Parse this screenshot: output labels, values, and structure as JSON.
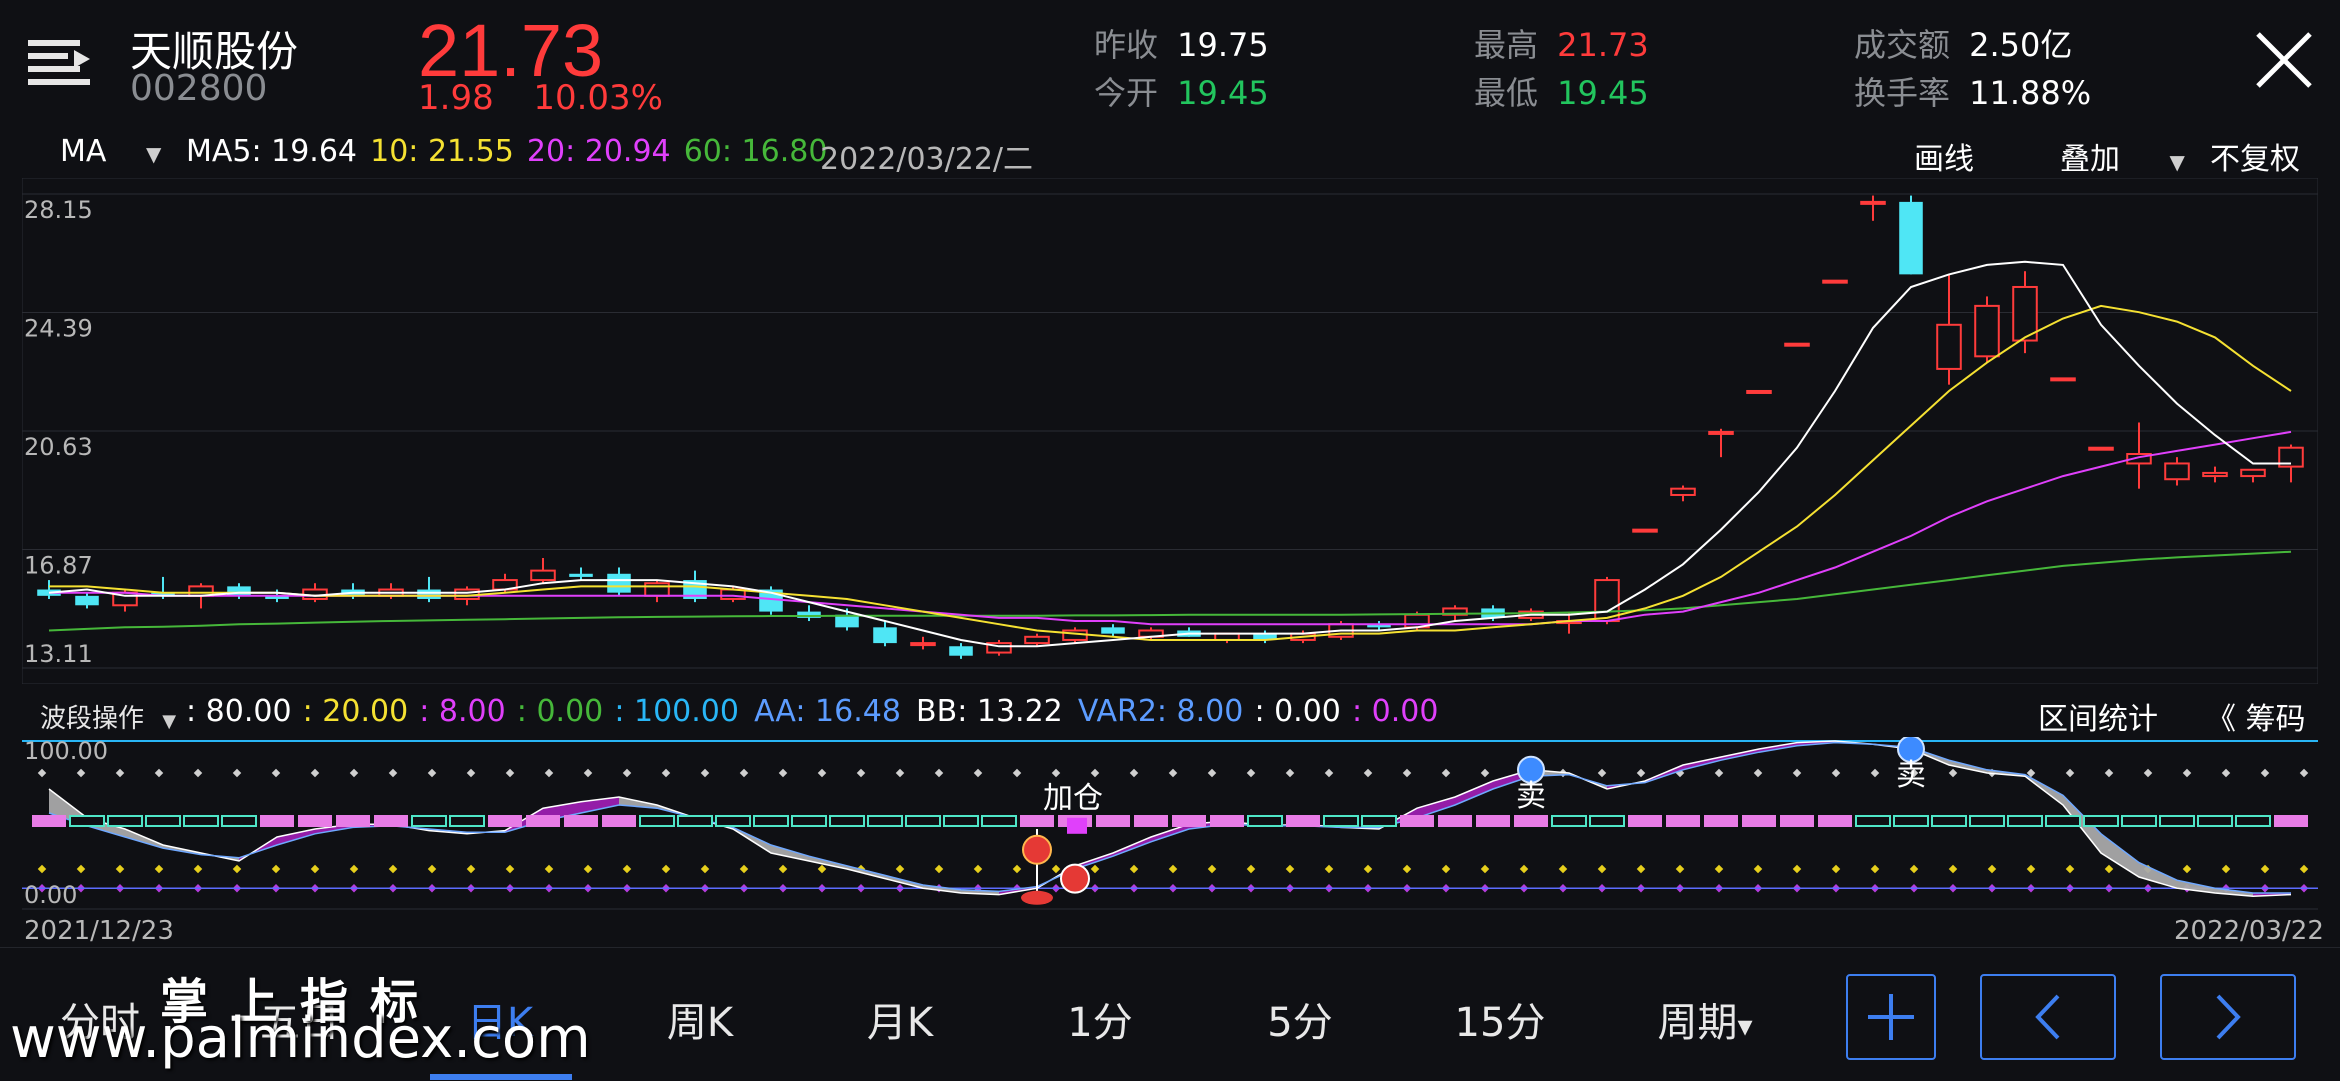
{
  "header": {
    "stock_name": "天顺股份",
    "stock_code": "002800",
    "last_price": "21.73",
    "change": "1.98",
    "change_pct": "10.03%",
    "quotes": [
      {
        "label": "昨收",
        "value": "19.75",
        "color": "#ffffff"
      },
      {
        "label": "今开",
        "value": "19.45",
        "color": "#22c55e"
      },
      {
        "label": "最高",
        "value": "21.73",
        "color": "#ff3b3b"
      },
      {
        "label": "最低",
        "value": "19.45",
        "color": "#22c55e"
      },
      {
        "label": "成交额",
        "value": "2.50亿",
        "color": "#ffffff"
      },
      {
        "label": "换手率",
        "value": "11.88%",
        "color": "#ffffff"
      }
    ],
    "icons": {
      "menu": "menu-icon",
      "close": "close-icon"
    }
  },
  "ma_row": {
    "selector": "MA",
    "items": [
      {
        "text": "MA5: 19.64",
        "color": "#ffffff"
      },
      {
        "text": "10: 21.55",
        "color": "#f5e132"
      },
      {
        "text": "20: 20.94",
        "color": "#e040fb"
      },
      {
        "text": "60: 16.80",
        "color": "#46b83a"
      }
    ],
    "date": "2022/03/22/二",
    "draw": "画线",
    "overlay": "叠加",
    "adjust": "不复权"
  },
  "indicator_row": {
    "selector": "波段操作",
    "items": [
      {
        "text": ": 80.00",
        "color": "#ffffff"
      },
      {
        "text": ": 20.00",
        "color": "#f5e132"
      },
      {
        "text": ": 8.00",
        "color": "#e040fb"
      },
      {
        "text": ": 0.00",
        "color": "#46b83a"
      },
      {
        "text": ": 100.00",
        "color": "#29b6f6"
      },
      {
        "text": "AA: 16.48",
        "color": "#5c9cff"
      },
      {
        "text": "BB: 13.22",
        "color": "#ffffff"
      },
      {
        "text": "VAR2: 8.00",
        "color": "#5c9cff"
      },
      {
        "text": ": 0.00",
        "color": "#ffffff"
      },
      {
        "text": ": 0.00",
        "color": "#e040fb"
      }
    ],
    "range_stats": "区间统计",
    "chips": "《 筹码"
  },
  "chart_data": {
    "type": "candlestick",
    "y_ticks": [
      "28.15",
      "24.39",
      "20.63",
      "16.87",
      "13.11"
    ],
    "ylim": [
      13.11,
      28.15
    ],
    "x_start_label": "2021/12/23",
    "x_end_label": "2022/03/22",
    "colors": {
      "up": "#ff3b3b",
      "down": "#4fe6f5",
      "ma5": "#ffffff",
      "ma10": "#f5e132",
      "ma20": "#e040fb",
      "ma60": "#46b83a"
    },
    "candles": [
      [
        15.6,
        15.9,
        15.3,
        15.4
      ],
      [
        15.4,
        15.5,
        15.0,
        15.1
      ],
      [
        15.1,
        15.6,
        14.9,
        15.5
      ],
      [
        15.5,
        16.0,
        15.3,
        15.4
      ],
      [
        15.4,
        15.8,
        15.0,
        15.7
      ],
      [
        15.7,
        15.8,
        15.3,
        15.4
      ],
      [
        15.4,
        15.6,
        15.2,
        15.3
      ],
      [
        15.3,
        15.8,
        15.2,
        15.6
      ],
      [
        15.6,
        15.8,
        15.3,
        15.4
      ],
      [
        15.4,
        15.8,
        15.3,
        15.6
      ],
      [
        15.6,
        16.0,
        15.2,
        15.3
      ],
      [
        15.3,
        15.7,
        15.1,
        15.6
      ],
      [
        15.6,
        16.1,
        15.5,
        15.9
      ],
      [
        15.9,
        16.6,
        15.8,
        16.2
      ],
      [
        16.1,
        16.3,
        15.9,
        16.0
      ],
      [
        16.1,
        16.3,
        15.4,
        15.5
      ],
      [
        15.4,
        15.9,
        15.2,
        15.8
      ],
      [
        15.9,
        16.2,
        15.2,
        15.3
      ],
      [
        15.3,
        15.7,
        15.2,
        15.6
      ],
      [
        15.6,
        15.7,
        14.8,
        14.9
      ],
      [
        14.9,
        15.1,
        14.6,
        14.7
      ],
      [
        14.8,
        15.0,
        14.3,
        14.4
      ],
      [
        14.4,
        14.6,
        13.8,
        13.9
      ],
      [
        13.9,
        14.1,
        13.7,
        13.9
      ],
      [
        13.8,
        13.9,
        13.4,
        13.5
      ],
      [
        13.6,
        14.0,
        13.5,
        13.9
      ],
      [
        13.9,
        14.2,
        13.8,
        14.1
      ],
      [
        14.0,
        14.4,
        13.9,
        14.3
      ],
      [
        14.4,
        14.5,
        14.1,
        14.2
      ],
      [
        14.1,
        14.4,
        14.0,
        14.3
      ],
      [
        14.3,
        14.4,
        14.1,
        14.1
      ],
      [
        14.0,
        14.2,
        13.9,
        14.2
      ],
      [
        14.2,
        14.3,
        13.9,
        14.0
      ],
      [
        14.0,
        14.3,
        13.9,
        14.2
      ],
      [
        14.1,
        14.6,
        14.0,
        14.5
      ],
      [
        14.5,
        14.6,
        14.3,
        14.4
      ],
      [
        14.4,
        14.9,
        14.3,
        14.8
      ],
      [
        14.8,
        15.1,
        14.6,
        15.0
      ],
      [
        15.0,
        15.1,
        14.6,
        14.7
      ],
      [
        14.7,
        15.0,
        14.6,
        14.9
      ],
      [
        14.6,
        14.9,
        14.2,
        14.6
      ],
      [
        14.6,
        16.0,
        14.5,
        15.9
      ],
      [
        17.5,
        17.5,
        17.5,
        17.5
      ],
      [
        18.6,
        18.9,
        18.4,
        18.8
      ],
      [
        20.6,
        20.7,
        19.8,
        20.6
      ],
      [
        21.9,
        21.9,
        21.9,
        21.9
      ],
      [
        23.4,
        23.4,
        23.4,
        23.4
      ],
      [
        25.4,
        25.4,
        25.4,
        25.4
      ],
      [
        27.9,
        28.1,
        27.3,
        27.9
      ],
      [
        27.9,
        28.1,
        25.6,
        25.6
      ],
      [
        22.6,
        25.6,
        22.1,
        24.0
      ],
      [
        23.0,
        24.9,
        22.8,
        24.6
      ],
      [
        23.5,
        25.7,
        23.1,
        25.2
      ],
      [
        22.3,
        22.3,
        22.3,
        22.3
      ],
      [
        20.1,
        20.1,
        20.1,
        20.1
      ],
      [
        19.6,
        20.9,
        18.8,
        19.9
      ],
      [
        19.1,
        19.8,
        18.9,
        19.6
      ],
      [
        19.2,
        19.5,
        19.0,
        19.3
      ],
      [
        19.2,
        19.4,
        19.0,
        19.4
      ],
      [
        19.5,
        20.2,
        19.0,
        20.1
      ]
    ],
    "ma5": [
      15.5,
      15.6,
      15.4,
      15.4,
      15.4,
      15.5,
      15.5,
      15.4,
      15.5,
      15.5,
      15.5,
      15.5,
      15.6,
      15.8,
      15.9,
      15.9,
      15.9,
      15.8,
      15.7,
      15.5,
      15.2,
      14.9,
      14.6,
      14.3,
      14.0,
      13.8,
      13.8,
      13.9,
      14.0,
      14.1,
      14.2,
      14.2,
      14.2,
      14.2,
      14.3,
      14.3,
      14.4,
      14.6,
      14.7,
      14.8,
      14.8,
      14.9,
      15.6,
      16.4,
      17.5,
      18.7,
      20.1,
      21.9,
      23.9,
      25.2,
      25.6,
      25.9,
      26.0,
      25.9,
      24.0,
      22.7,
      21.5,
      20.5,
      19.6,
      19.6
    ],
    "ma10": [
      15.7,
      15.7,
      15.6,
      15.5,
      15.5,
      15.5,
      15.5,
      15.4,
      15.4,
      15.4,
      15.4,
      15.4,
      15.5,
      15.6,
      15.7,
      15.7,
      15.7,
      15.7,
      15.6,
      15.5,
      15.4,
      15.3,
      15.1,
      14.9,
      14.7,
      14.5,
      14.3,
      14.2,
      14.1,
      14.0,
      14.0,
      14.0,
      14.0,
      14.1,
      14.2,
      14.2,
      14.3,
      14.3,
      14.4,
      14.5,
      14.6,
      14.7,
      15.0,
      15.4,
      16.0,
      16.8,
      17.6,
      18.6,
      19.7,
      20.8,
      21.9,
      22.8,
      23.6,
      24.2,
      24.6,
      24.4,
      24.1,
      23.6,
      22.7,
      21.9
    ],
    "ma20": [
      15.5,
      15.5,
      15.5,
      15.4,
      15.4,
      15.4,
      15.4,
      15.4,
      15.4,
      15.4,
      15.4,
      15.4,
      15.4,
      15.4,
      15.4,
      15.4,
      15.4,
      15.4,
      15.4,
      15.3,
      15.2,
      15.1,
      15.0,
      14.9,
      14.8,
      14.7,
      14.7,
      14.6,
      14.6,
      14.5,
      14.5,
      14.5,
      14.5,
      14.5,
      14.5,
      14.5,
      14.5,
      14.5,
      14.5,
      14.5,
      14.6,
      14.6,
      14.8,
      14.9,
      15.2,
      15.5,
      15.9,
      16.3,
      16.8,
      17.3,
      17.9,
      18.4,
      18.8,
      19.2,
      19.5,
      19.8,
      20.0,
      20.2,
      20.4,
      20.6
    ],
    "ma60": [
      14.3,
      14.35,
      14.4,
      14.42,
      14.45,
      14.5,
      14.52,
      14.55,
      14.58,
      14.6,
      14.62,
      14.64,
      14.66,
      14.68,
      14.7,
      14.72,
      14.73,
      14.74,
      14.75,
      14.76,
      14.76,
      14.77,
      14.77,
      14.77,
      14.77,
      14.77,
      14.77,
      14.78,
      14.78,
      14.79,
      14.8,
      14.8,
      14.8,
      14.8,
      14.8,
      14.81,
      14.82,
      14.83,
      14.84,
      14.85,
      14.87,
      14.9,
      14.94,
      15.0,
      15.1,
      15.2,
      15.3,
      15.45,
      15.6,
      15.75,
      15.9,
      16.05,
      16.2,
      16.35,
      16.45,
      16.55,
      16.62,
      16.68,
      16.74,
      16.8
    ]
  },
  "indicator_chart": {
    "y_ticks": [
      "100.00",
      "0.00"
    ],
    "ylim": [
      0,
      100
    ],
    "levels": {
      "top": 100,
      "upper_dots": 80,
      "mid": 50,
      "lower_dots": 20,
      "bottom_dots": 8
    },
    "fast": [
      70,
      52,
      45,
      35,
      30,
      25,
      40,
      45,
      48,
      48,
      44,
      42,
      44,
      58,
      62,
      65,
      60,
      52,
      45,
      30,
      25,
      20,
      14,
      8,
      5,
      4,
      8,
      22,
      30,
      40,
      48,
      50,
      47,
      48,
      46,
      45,
      58,
      65,
      75,
      82,
      80,
      70,
      75,
      85,
      90,
      95,
      99,
      100,
      98,
      95,
      85,
      80,
      78,
      60,
      30,
      15,
      8,
      5,
      3,
      4
    ],
    "slow": [
      55,
      47,
      40,
      33,
      29,
      27,
      35,
      42,
      46,
      47,
      45,
      43,
      43,
      50,
      55,
      60,
      58,
      52,
      46,
      35,
      28,
      22,
      16,
      10,
      7,
      6,
      9,
      20,
      28,
      37,
      45,
      48,
      47,
      47,
      46,
      46,
      52,
      60,
      70,
      78,
      79,
      72,
      74,
      82,
      88,
      93,
      97,
      99,
      98,
      96,
      88,
      82,
      79,
      66,
      42,
      24,
      13,
      8,
      5,
      5
    ],
    "labels": [
      {
        "text": "加仓",
        "index": 26
      },
      {
        "text": "卖",
        "index": 39
      },
      {
        "text": "卖",
        "index": 49
      }
    ]
  },
  "bottom_nav": {
    "tabs": [
      "分时",
      "五日",
      "日K",
      "周K",
      "月K",
      "1分",
      "5分",
      "15分",
      "周期"
    ],
    "active": 2,
    "period_caret": "▾",
    "buttons": {
      "add": "+",
      "prev": "<",
      "next": ">"
    }
  },
  "watermark": {
    "cn": "掌上指标",
    "url": "www.palmindex.com"
  }
}
